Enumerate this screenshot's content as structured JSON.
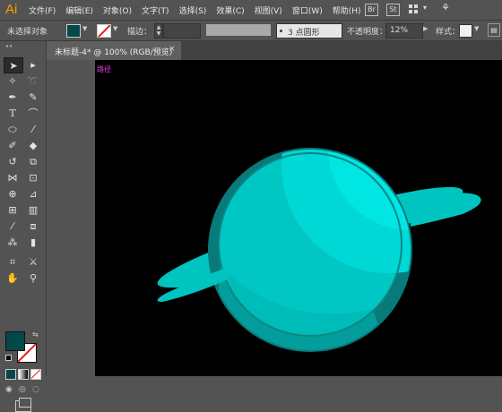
{
  "app": {
    "logo": "Ai",
    "menus": [
      "文件(F)",
      "编辑(E)",
      "对象(O)",
      "文字(T)",
      "选择(S)",
      "效果(C)",
      "视图(V)",
      "窗口(W)",
      "帮助(H)"
    ],
    "bridge_label": "Br",
    "stock_label": "St"
  },
  "control_bar": {
    "selection_status": "未选择对象",
    "stroke_label": "描边：",
    "brush_label": "3 点圆形",
    "opacity_label": "不透明度：",
    "opacity_value": "12%",
    "style_label": "样式："
  },
  "document": {
    "tab_title": "未标题-4* @ 100% (RGB/预览)",
    "close_glyph": "×",
    "path_hint": "路径"
  },
  "colors": {
    "fill": "#05484a",
    "stroke": "none",
    "planet_light": "#00c7c4",
    "planet_dark": "#087a7a",
    "planet_highlight": "#00eeec",
    "ring": "#00c4c0"
  },
  "tools": [
    "selection-tool",
    "direct-selection-tool",
    "magic-wand-tool",
    "lasso-tool",
    "pen-tool",
    "curvature-tool",
    "type-tool",
    "arc-tool",
    "ellipse-tool",
    "paintbrush-tool",
    "shaper-tool",
    "eraser-tool",
    "rotate-tool",
    "scale-tool",
    "width-tool",
    "free-transform-tool",
    "shape-builder-tool",
    "perspective-tool",
    "mesh-tool",
    "gradient-tool",
    "eyedropper-tool",
    "blend-tool",
    "symbol-sprayer-tool",
    "column-graph-tool",
    "artboard-tool",
    "slice-tool",
    "hand-tool",
    "zoom-tool"
  ]
}
